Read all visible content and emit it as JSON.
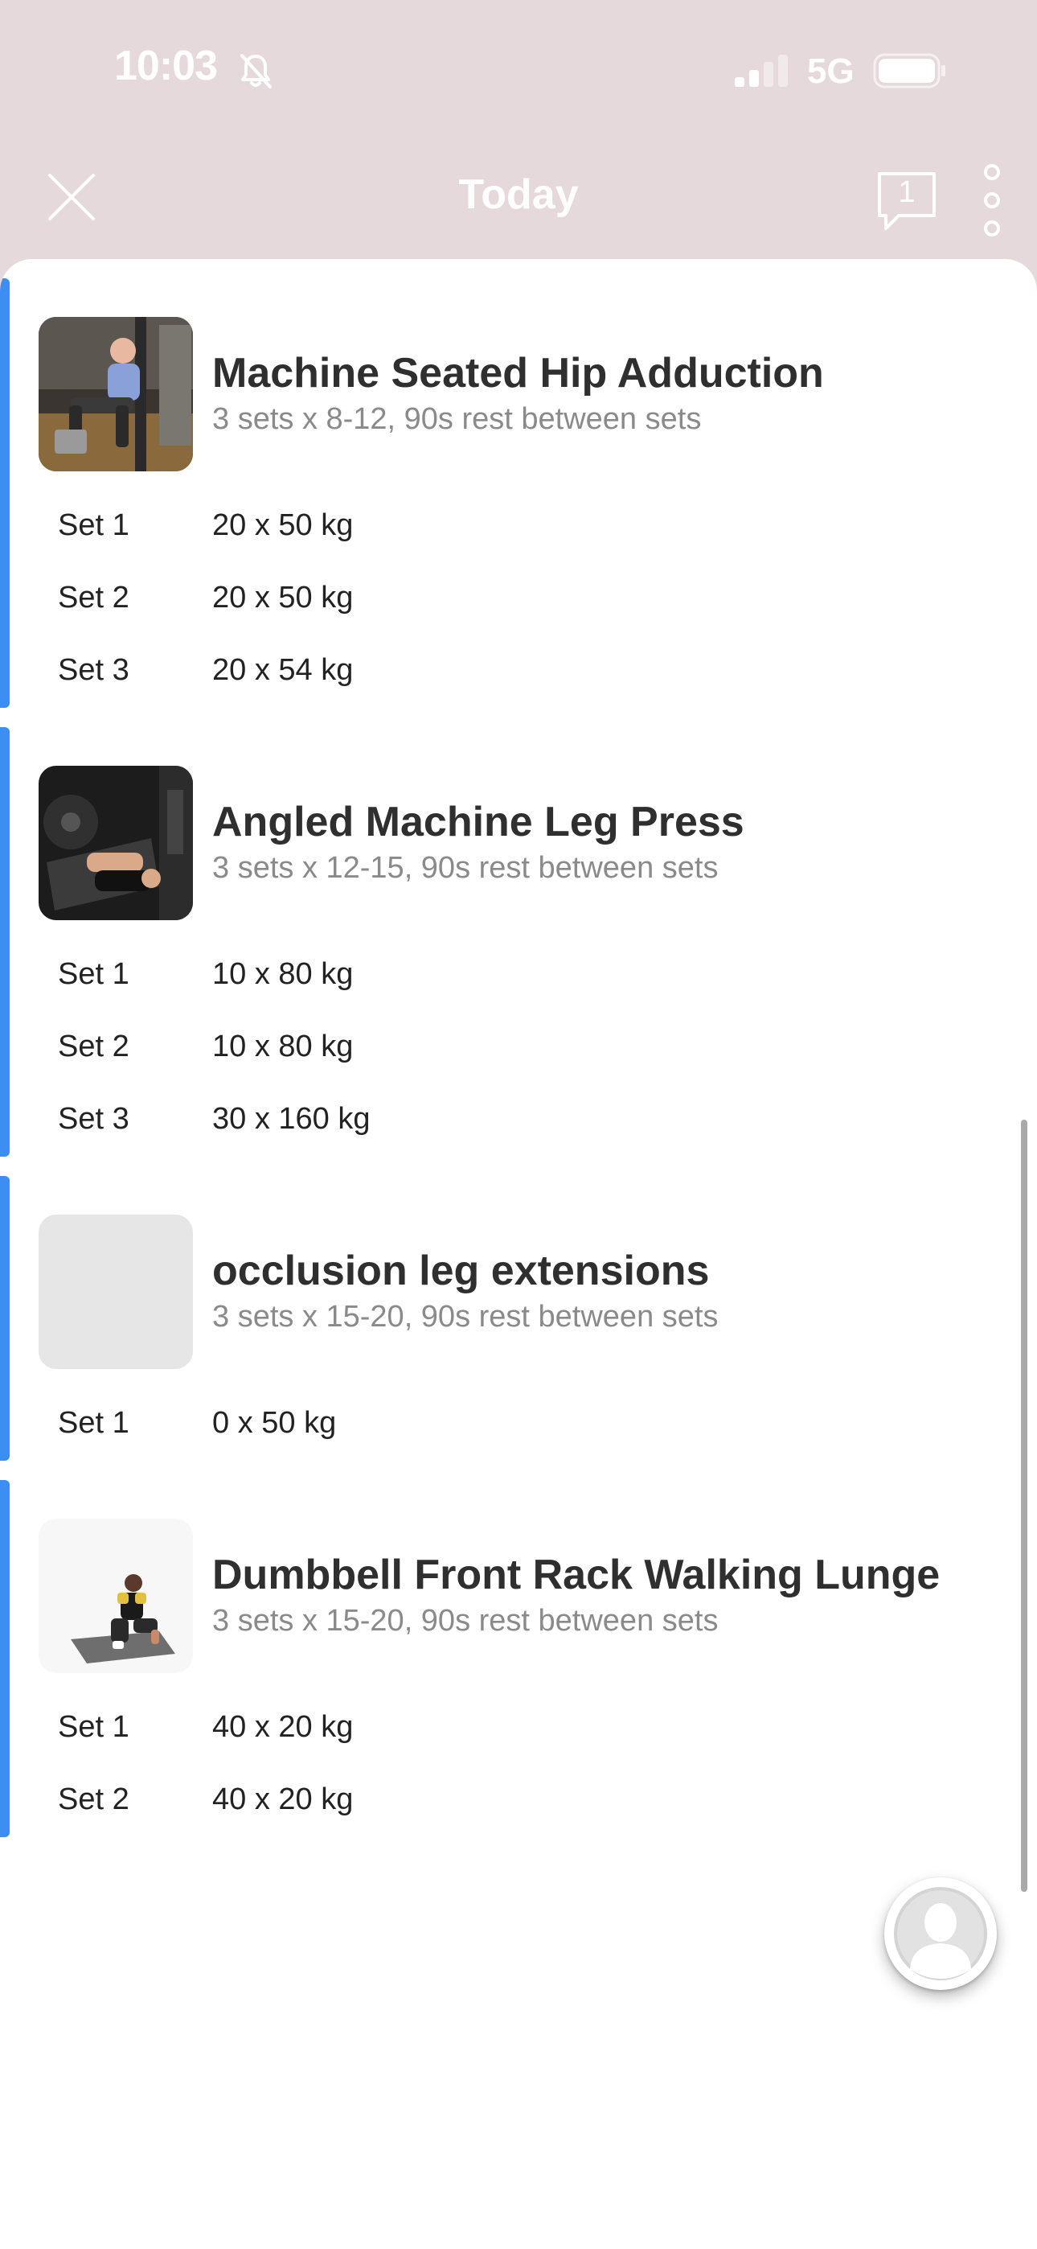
{
  "status_bar": {
    "time": "10:03",
    "network": "5G",
    "icons": [
      "bell-slash-icon",
      "signal-icon",
      "battery-icon"
    ]
  },
  "nav": {
    "title": "Today",
    "chat_count": "1",
    "icons": [
      "close-icon",
      "chat-icon",
      "more-vertical-icon"
    ]
  },
  "colors": {
    "accent": "#3c8ef2",
    "header_bg": "#e5d9db"
  },
  "exercises": [
    {
      "name": "Machine Seated Hip Adduction",
      "prescription": "3 sets x 8-12, 90s rest between sets",
      "sets": [
        {
          "label": "Set 1",
          "value": "20 x 50 kg"
        },
        {
          "label": "Set 2",
          "value": "20 x 50 kg"
        },
        {
          "label": "Set 3",
          "value": "20 x 54 kg"
        }
      ]
    },
    {
      "name": "Angled Machine Leg Press",
      "prescription": "3 sets x 12-15, 90s rest between sets",
      "sets": [
        {
          "label": "Set 1",
          "value": "10 x 80 kg"
        },
        {
          "label": "Set 2",
          "value": "10 x 80 kg"
        },
        {
          "label": "Set 3",
          "value": "30 x 160 kg"
        }
      ]
    },
    {
      "name": "occlusion leg extensions",
      "prescription": "3 sets x 15-20, 90s rest between sets",
      "sets": [
        {
          "label": "Set 1",
          "value": "0 x 50 kg"
        }
      ]
    },
    {
      "name": "Dumbbell Front Rack Walking Lunge",
      "prescription": "3 sets x 15-20, 90s rest between sets",
      "sets": [
        {
          "label": "Set 1",
          "value": "40 x 20 kg"
        },
        {
          "label": "Set 2",
          "value": "40 x 20 kg"
        }
      ]
    }
  ]
}
